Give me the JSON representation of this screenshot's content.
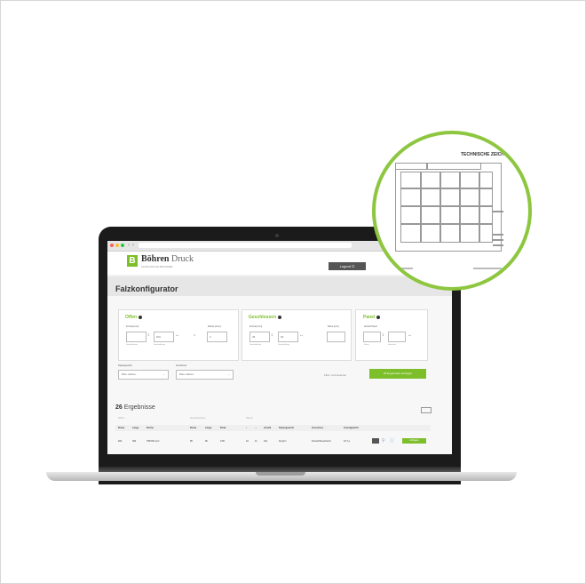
{
  "brand": {
    "name": "Böhren",
    "suffix": " Druck",
    "tagline": "GRAPHISCHE BETRIEBE"
  },
  "header": {
    "logout_label": "Logout"
  },
  "page": {
    "title": "Falzkonfigurator"
  },
  "panels": {
    "offen": {
      "title": "Offen",
      "format_label": "Format [mm]",
      "area_label": "Fläche [mm²]",
      "width_value": "",
      "height_value": "600",
      "area_value": "0",
      "sub_width": "Standardbreite",
      "sub_height": "Standardlänge"
    },
    "geschlossen": {
      "title": "Geschlossen",
      "format_label": "Format [mm]",
      "thickness_label": "Dicke [mm]",
      "width_value": "35",
      "height_value": "90",
      "sub_width": "Standardbreite",
      "sub_height": "Standardlänge"
    },
    "panel": {
      "title": "Panel",
      "count_label": "Anzahl Panel",
      "sub_a": "Seiten",
      "sub_b": "Horizontal"
    }
  },
  "filters": {
    "paper_label": "Papiergewicht",
    "paper_value": "Bitte wählen",
    "closure_label": "Verschluss",
    "closure_value": "Bitte wählen",
    "reset_label": "Filter zurücksetzen",
    "show_label": "26 Ergebnisse anzeigen"
  },
  "results": {
    "count": "26",
    "label": " Ergebnisse"
  },
  "table": {
    "groups": [
      "Offen",
      "Geschlossen",
      "Panel"
    ],
    "headers": [
      "Breite",
      "Länge",
      "Fläche",
      "Breite",
      "Länge",
      "Dicke",
      "↕",
      "↔",
      "Anzahl",
      "Papiergewicht",
      "Verschluss",
      "Grundgewicht"
    ],
    "row": [
      "400",
      "300",
      "750'000 mm²",
      "95",
      "90",
      "0.50",
      "10",
      "11",
      "110",
      "40 g/m²",
      "Fünsch/Kreuzbruch",
      "16.7 g"
    ],
    "action_label": "Anfragen"
  },
  "drawing": {
    "title": "TECHNISCHE ZEICH"
  },
  "colors": {
    "accent": "#7dbf2b",
    "ring": "#8dc63f"
  }
}
